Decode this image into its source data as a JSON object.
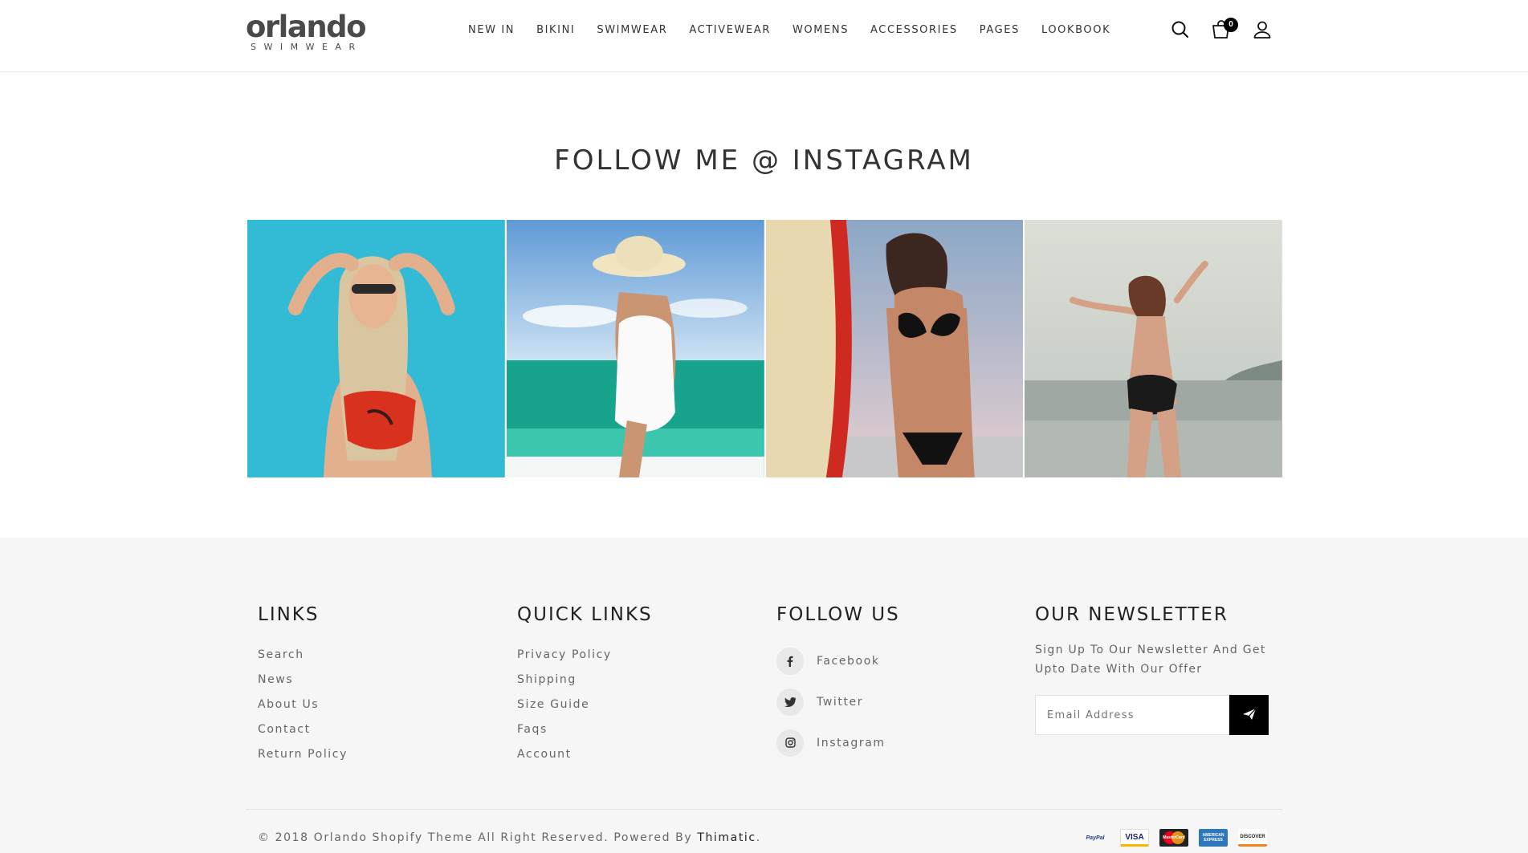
{
  "brand": {
    "name": "orlando",
    "tagline": "SWIMWEAR"
  },
  "nav": [
    "NEW IN",
    "BIKINI",
    "SWIMWEAR",
    "ACTIVEWEAR",
    "WOMENS",
    "ACCESSORIES",
    "PAGES",
    "LOOKBOOK"
  ],
  "header_icons": {
    "search": "search-icon",
    "cart": "cart-icon",
    "cart_count": "0",
    "account": "user-icon"
  },
  "instagram": {
    "title": "FOLLOW ME @ INSTAGRAM",
    "tiles": [
      "woman in red bikini top against turquoise wall",
      "woman in white swimsuit and straw hat at sea",
      "woman in black bikini with red surfboard",
      "woman in black bikini at beach with arms raised"
    ]
  },
  "footer": {
    "links": {
      "title": "LINKS",
      "items": [
        "Search",
        "News",
        "About Us",
        "Contact",
        "Return Policy"
      ]
    },
    "quick_links": {
      "title": "QUICK LINKS",
      "items": [
        "Privacy Policy",
        "Shipping",
        "Size Guide",
        "Faqs",
        "Account"
      ]
    },
    "follow_us": {
      "title": "FOLLOW US",
      "items": [
        {
          "label": "Facebook",
          "icon": "facebook-icon"
        },
        {
          "label": "Twitter",
          "icon": "twitter-icon"
        },
        {
          "label": "Instagram",
          "icon": "instagram-icon"
        }
      ]
    },
    "newsletter": {
      "title": "OUR NEWSLETTER",
      "text": "Sign Up To Our Newsletter And Get Upto Date With Our Offer",
      "placeholder": "Email Address",
      "button_icon": "send-icon"
    },
    "copyright": "© 2018 Orlando Shopify Theme All Right Reserved. Powered By ",
    "powered_by": "Thimatic",
    "copyright_end": ".",
    "payments": [
      "PayPal",
      "VISA",
      "MasterCard",
      "AMERICAN EXPRESS",
      "DISCOVER"
    ]
  },
  "colors": {
    "footer_bg": "#f6f6f6",
    "accent": "#000000",
    "text": "#333333"
  }
}
